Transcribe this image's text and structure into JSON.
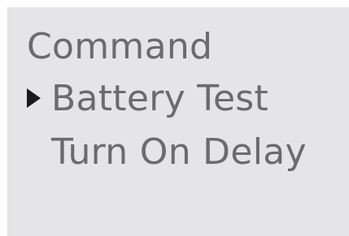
{
  "menu": {
    "title": "Command",
    "items": [
      {
        "label": "Battery Test",
        "selected": true
      },
      {
        "label": "Turn On Delay",
        "selected": false
      }
    ],
    "cursor_icon": "triangle-right-icon"
  },
  "colors": {
    "screen_bg": "#e5e5e7",
    "text": "#6b6b6d",
    "cursor": "#1a1a1a"
  }
}
